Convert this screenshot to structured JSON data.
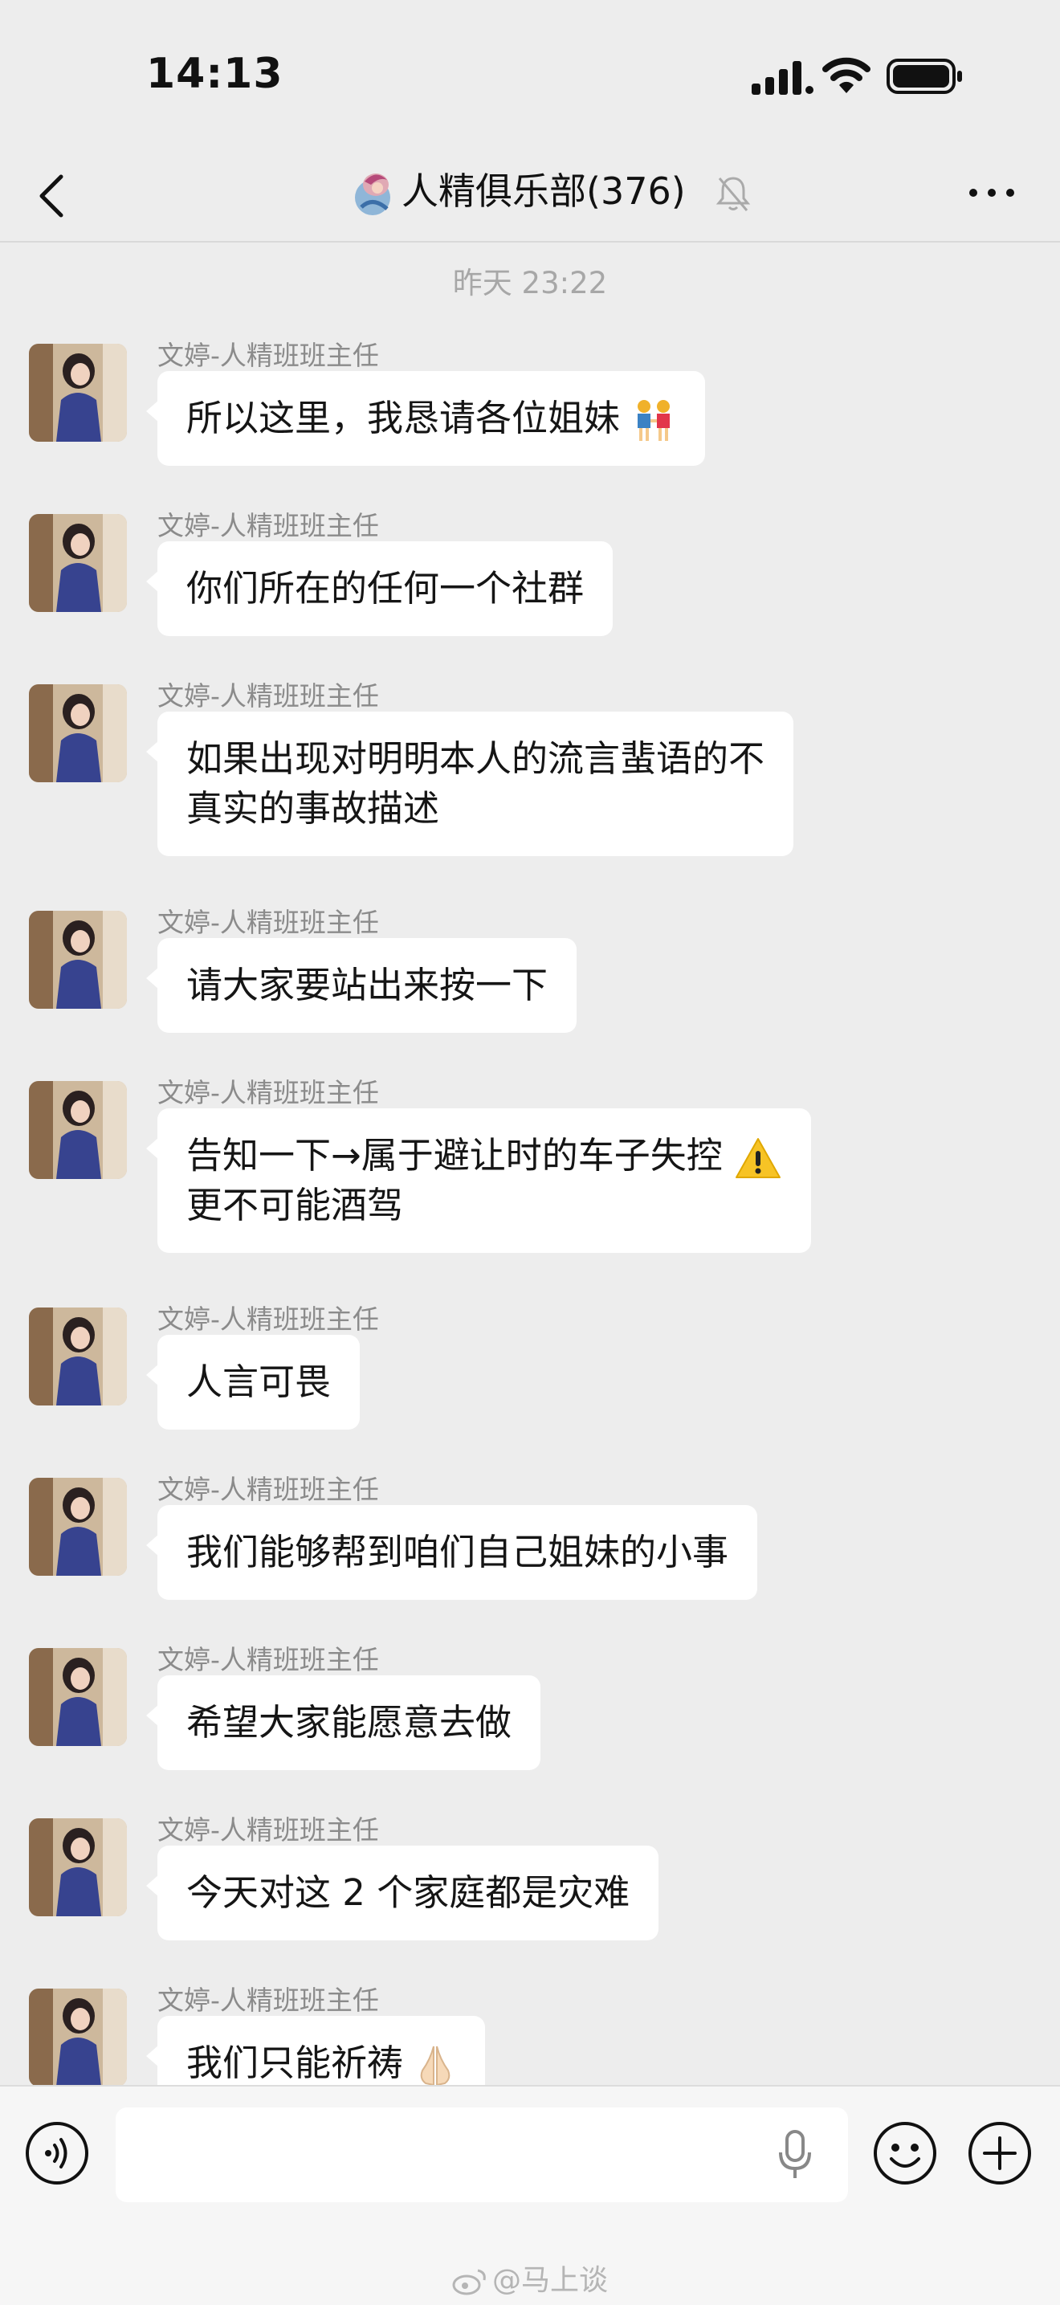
{
  "status_bar": {
    "time": "14:13"
  },
  "nav": {
    "title": "人精俱乐部(376)"
  },
  "chat": {
    "timestamp": "昨天 23:22",
    "sender": "文婷-人精班班主任",
    "messages": [
      {
        "line1": "所以这里，我恳请各位姐妹",
        "emoji": "girls-holding-hands"
      },
      {
        "line1": "你们所在的任何一个社群"
      },
      {
        "line1": "如果出现对明明本人的流言蜚语的不",
        "line2": "真实的事故描述"
      },
      {
        "line1": "请大家要站出来按一下"
      },
      {
        "line1": "告知一下→属于避让时的车子失控",
        "emoji": "warning",
        "line2": "更不可能酒驾"
      },
      {
        "line1": "人言可畏"
      },
      {
        "line1": "我们能够帮到咱们自己姐妹的小事"
      },
      {
        "line1": "希望大家能愿意去做"
      },
      {
        "line1": "今天对这 2 个家庭都是灾难"
      },
      {
        "line1": "我们只能祈祷",
        "emoji": "folded-hands"
      }
    ]
  },
  "watermark": "@马上谈",
  "colors": {
    "background": "#ededed",
    "bubble": "#ffffff",
    "meta_text": "#8b8b8b"
  }
}
